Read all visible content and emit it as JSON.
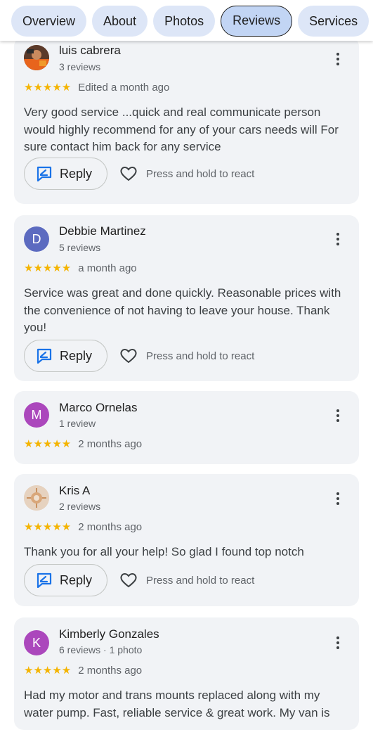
{
  "tabs": [
    {
      "label": "Overview"
    },
    {
      "label": "About"
    },
    {
      "label": "Photos"
    },
    {
      "label": "Reviews",
      "active": true
    },
    {
      "label": "Services"
    }
  ],
  "actions": {
    "reply_label": "Reply",
    "react_hint": "Press and hold to react"
  },
  "colors": {
    "accent": "#1a73e8",
    "star": "#f4b400",
    "avatar_d": "#5c6bc0",
    "avatar_m": "#ab47bc",
    "avatar_k": "#ab47bc"
  },
  "reviews": [
    {
      "author": "luis cabrera",
      "meta": "3 reviews",
      "rating": 5,
      "stars": "★★★★★",
      "when": "Edited a month ago",
      "text": "Very good service ...quick and real communicate person would highly recommend for any of your cars needs will For sure contact him back for any service",
      "avatar_initial": ""
    },
    {
      "author": "Debbie Martinez",
      "meta": "5 reviews",
      "rating": 5,
      "stars": "★★★★★",
      "when": "a month ago",
      "text": "Service was great and done quickly. Reasonable prices with the convenience of not having to leave your house. Thank you!",
      "avatar_initial": "D"
    },
    {
      "author": "Marco Ornelas",
      "meta": "1 review",
      "rating": 5,
      "stars": "★★★★★",
      "when": "2 months ago",
      "text": "",
      "avatar_initial": "M"
    },
    {
      "author": "Kris A",
      "meta": "2 reviews",
      "rating": 5,
      "stars": "★★★★★",
      "when": "2 months ago",
      "text": "Thank you for all your help! So glad I found top notch",
      "avatar_initial": ""
    },
    {
      "author": "Kimberly Gonzales",
      "meta": "6 reviews · 1 photo",
      "rating": 5,
      "stars": "★★★★★",
      "when": "2 months ago",
      "text": "Had my motor and trans mounts replaced along with my water pump. Fast, reliable service & great work. My van is",
      "avatar_initial": "K"
    }
  ]
}
